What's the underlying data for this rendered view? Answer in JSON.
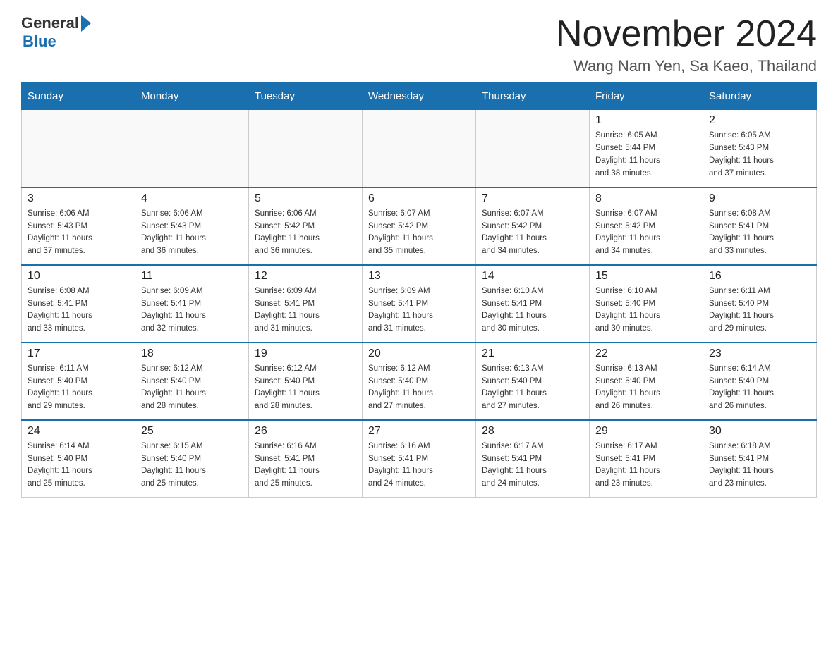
{
  "logo": {
    "general": "General",
    "blue": "Blue"
  },
  "header": {
    "title": "November 2024",
    "location": "Wang Nam Yen, Sa Kaeo, Thailand"
  },
  "weekdays": [
    "Sunday",
    "Monday",
    "Tuesday",
    "Wednesday",
    "Thursday",
    "Friday",
    "Saturday"
  ],
  "weeks": [
    [
      {
        "day": "",
        "info": ""
      },
      {
        "day": "",
        "info": ""
      },
      {
        "day": "",
        "info": ""
      },
      {
        "day": "",
        "info": ""
      },
      {
        "day": "",
        "info": ""
      },
      {
        "day": "1",
        "info": "Sunrise: 6:05 AM\nSunset: 5:44 PM\nDaylight: 11 hours\nand 38 minutes."
      },
      {
        "day": "2",
        "info": "Sunrise: 6:05 AM\nSunset: 5:43 PM\nDaylight: 11 hours\nand 37 minutes."
      }
    ],
    [
      {
        "day": "3",
        "info": "Sunrise: 6:06 AM\nSunset: 5:43 PM\nDaylight: 11 hours\nand 37 minutes."
      },
      {
        "day": "4",
        "info": "Sunrise: 6:06 AM\nSunset: 5:43 PM\nDaylight: 11 hours\nand 36 minutes."
      },
      {
        "day": "5",
        "info": "Sunrise: 6:06 AM\nSunset: 5:42 PM\nDaylight: 11 hours\nand 36 minutes."
      },
      {
        "day": "6",
        "info": "Sunrise: 6:07 AM\nSunset: 5:42 PM\nDaylight: 11 hours\nand 35 minutes."
      },
      {
        "day": "7",
        "info": "Sunrise: 6:07 AM\nSunset: 5:42 PM\nDaylight: 11 hours\nand 34 minutes."
      },
      {
        "day": "8",
        "info": "Sunrise: 6:07 AM\nSunset: 5:42 PM\nDaylight: 11 hours\nand 34 minutes."
      },
      {
        "day": "9",
        "info": "Sunrise: 6:08 AM\nSunset: 5:41 PM\nDaylight: 11 hours\nand 33 minutes."
      }
    ],
    [
      {
        "day": "10",
        "info": "Sunrise: 6:08 AM\nSunset: 5:41 PM\nDaylight: 11 hours\nand 33 minutes."
      },
      {
        "day": "11",
        "info": "Sunrise: 6:09 AM\nSunset: 5:41 PM\nDaylight: 11 hours\nand 32 minutes."
      },
      {
        "day": "12",
        "info": "Sunrise: 6:09 AM\nSunset: 5:41 PM\nDaylight: 11 hours\nand 31 minutes."
      },
      {
        "day": "13",
        "info": "Sunrise: 6:09 AM\nSunset: 5:41 PM\nDaylight: 11 hours\nand 31 minutes."
      },
      {
        "day": "14",
        "info": "Sunrise: 6:10 AM\nSunset: 5:41 PM\nDaylight: 11 hours\nand 30 minutes."
      },
      {
        "day": "15",
        "info": "Sunrise: 6:10 AM\nSunset: 5:40 PM\nDaylight: 11 hours\nand 30 minutes."
      },
      {
        "day": "16",
        "info": "Sunrise: 6:11 AM\nSunset: 5:40 PM\nDaylight: 11 hours\nand 29 minutes."
      }
    ],
    [
      {
        "day": "17",
        "info": "Sunrise: 6:11 AM\nSunset: 5:40 PM\nDaylight: 11 hours\nand 29 minutes."
      },
      {
        "day": "18",
        "info": "Sunrise: 6:12 AM\nSunset: 5:40 PM\nDaylight: 11 hours\nand 28 minutes."
      },
      {
        "day": "19",
        "info": "Sunrise: 6:12 AM\nSunset: 5:40 PM\nDaylight: 11 hours\nand 28 minutes."
      },
      {
        "day": "20",
        "info": "Sunrise: 6:12 AM\nSunset: 5:40 PM\nDaylight: 11 hours\nand 27 minutes."
      },
      {
        "day": "21",
        "info": "Sunrise: 6:13 AM\nSunset: 5:40 PM\nDaylight: 11 hours\nand 27 minutes."
      },
      {
        "day": "22",
        "info": "Sunrise: 6:13 AM\nSunset: 5:40 PM\nDaylight: 11 hours\nand 26 minutes."
      },
      {
        "day": "23",
        "info": "Sunrise: 6:14 AM\nSunset: 5:40 PM\nDaylight: 11 hours\nand 26 minutes."
      }
    ],
    [
      {
        "day": "24",
        "info": "Sunrise: 6:14 AM\nSunset: 5:40 PM\nDaylight: 11 hours\nand 25 minutes."
      },
      {
        "day": "25",
        "info": "Sunrise: 6:15 AM\nSunset: 5:40 PM\nDaylight: 11 hours\nand 25 minutes."
      },
      {
        "day": "26",
        "info": "Sunrise: 6:16 AM\nSunset: 5:41 PM\nDaylight: 11 hours\nand 25 minutes."
      },
      {
        "day": "27",
        "info": "Sunrise: 6:16 AM\nSunset: 5:41 PM\nDaylight: 11 hours\nand 24 minutes."
      },
      {
        "day": "28",
        "info": "Sunrise: 6:17 AM\nSunset: 5:41 PM\nDaylight: 11 hours\nand 24 minutes."
      },
      {
        "day": "29",
        "info": "Sunrise: 6:17 AM\nSunset: 5:41 PM\nDaylight: 11 hours\nand 23 minutes."
      },
      {
        "day": "30",
        "info": "Sunrise: 6:18 AM\nSunset: 5:41 PM\nDaylight: 11 hours\nand 23 minutes."
      }
    ]
  ]
}
